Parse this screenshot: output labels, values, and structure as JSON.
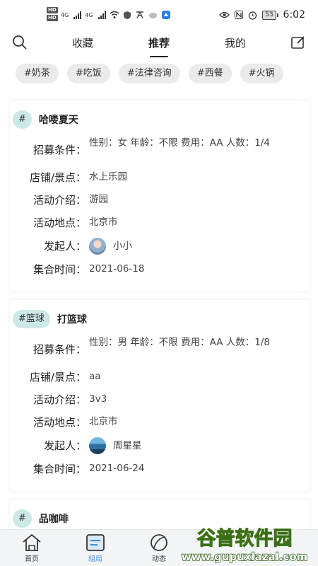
{
  "status_bar": {
    "hd1": "HD",
    "hd2": "HD",
    "net1": "4G",
    "net2": "4G",
    "battery": "53",
    "time": "6:02"
  },
  "header": {
    "tabs": [
      {
        "label": "收藏",
        "active": false
      },
      {
        "label": "推荐",
        "active": true
      },
      {
        "label": "我的",
        "active": false
      }
    ],
    "search_icon": "search-icon",
    "edit_icon": "edit-icon"
  },
  "tags": [
    "#奶茶",
    "#吃饭",
    "#法律咨询",
    "#西餐",
    "#火锅"
  ],
  "field_labels": {
    "requirements": "招募条件：",
    "store": "店铺/景点：",
    "intro": "活动介绍：",
    "location": "活动地点：",
    "initiator": "发起人：",
    "time": "集合时间："
  },
  "cards": [
    {
      "badge": "#",
      "title": "哈喽夏天",
      "requirements": "性别：女 年龄：不限 费用：AA 人数：1/4",
      "store": "水上乐园",
      "intro": "游园",
      "location": "北京市",
      "initiator": "小小",
      "time": "2021-06-18"
    },
    {
      "badge": "#篮球",
      "title": "打篮球",
      "requirements": "性别：男 年龄：不限 费用：AA 人数：1/8",
      "store": "aa",
      "intro": "3v3",
      "location": "北京市",
      "initiator": "周星星",
      "time": "2021-06-24"
    },
    {
      "badge": "#",
      "title": "品咖啡"
    }
  ],
  "bottom_nav": [
    {
      "label": "首页",
      "icon": "home-icon",
      "active": false
    },
    {
      "label": "组局",
      "icon": "group-icon",
      "active": true
    },
    {
      "label": "动态",
      "icon": "feed-icon",
      "active": false
    }
  ],
  "watermark": {
    "title": "谷普软件园",
    "url": "www.gupuxlazal.com"
  },
  "colors": {
    "badge_bg": "#cde9e6",
    "chip_bg": "#ebebeb",
    "active_nav": "#3c8bd8"
  }
}
